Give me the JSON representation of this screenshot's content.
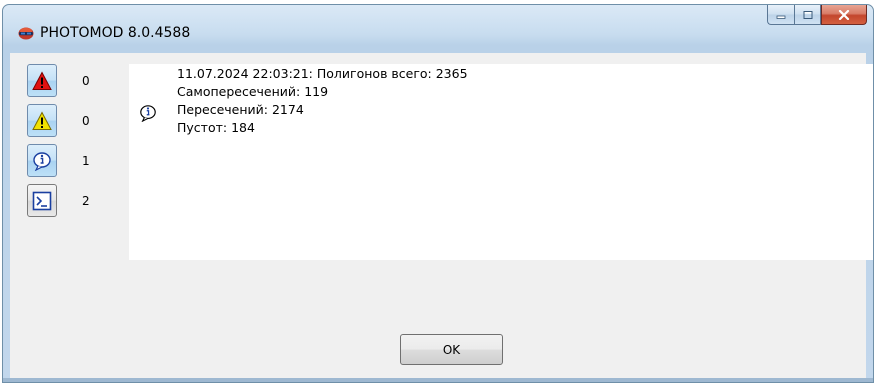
{
  "window": {
    "title": "PHOTOMOD 8.0.4588",
    "app_icon": "photomod-logo-icon",
    "caption_buttons": [
      "minimize-icon",
      "maximize-icon",
      "close-icon"
    ]
  },
  "filters": [
    {
      "name": "errors",
      "icon": "error-triangle-icon",
      "count": "0",
      "color": "#e01010"
    },
    {
      "name": "warnings",
      "icon": "warning-triangle-icon",
      "count": "0",
      "color": "#f0e000"
    },
    {
      "name": "info",
      "icon": "info-icon",
      "count": "1",
      "color": "#1a3fa0"
    },
    {
      "name": "console",
      "icon": "console-icon",
      "count": "2",
      "color": "#1a3fa0"
    }
  ],
  "log": {
    "entries": [
      {
        "icon": "info-icon",
        "lines": [
          "11.07.2024 22:03:21: Полигонов всего: 2365",
          "Самопересечений: 119",
          "Пересечений: 2174",
          "Пустот: 184"
        ]
      }
    ]
  },
  "buttons": {
    "ok_label": "OK"
  },
  "colors": {
    "frame": "#c2d7ec",
    "client": "#f0f0f0",
    "close_button": "#c3462d"
  }
}
